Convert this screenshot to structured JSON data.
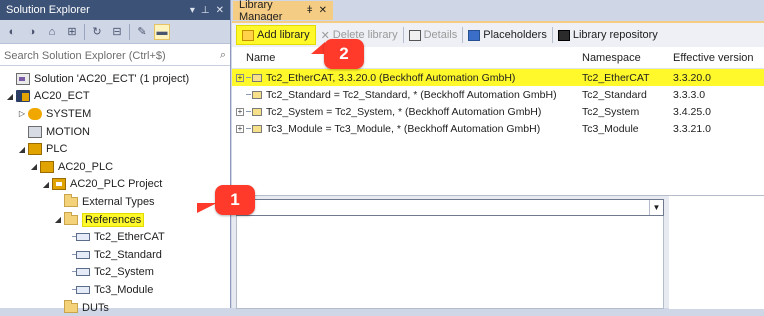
{
  "solution_explorer": {
    "title": "Solution Explorer",
    "title_icons": [
      "▾",
      "⊥",
      "✕"
    ],
    "search_placeholder": "Search Solution Explorer (Ctrl+$)",
    "search_icon": "⌕",
    "tree": [
      {
        "label": "Solution 'AC20_ECT' (1 project)",
        "icon": "solution-icon",
        "indent": 0,
        "expander": ""
      },
      {
        "label": "AC20_ECT",
        "icon": "project-icon",
        "indent": 0,
        "expander": "◢"
      },
      {
        "label": "SYSTEM",
        "icon": "system-icon",
        "indent": 1,
        "expander": "▷"
      },
      {
        "label": "MOTION",
        "icon": "motion-icon",
        "indent": 1,
        "expander": ""
      },
      {
        "label": "PLC",
        "icon": "plc-icon",
        "indent": 1,
        "expander": "◢"
      },
      {
        "label": "AC20_PLC",
        "icon": "plc-icon",
        "indent": 2,
        "expander": "◢"
      },
      {
        "label": "AC20_PLC Project",
        "icon": "plc-project-icon",
        "indent": 3,
        "expander": "◢"
      },
      {
        "label": "External Types",
        "icon": "folder-icon",
        "indent": 4,
        "expander": ""
      },
      {
        "label": "References",
        "icon": "folder-icon",
        "indent": 4,
        "expander": "◢",
        "selected": true
      },
      {
        "label": "Tc2_EtherCAT",
        "icon": "library-icon",
        "indent": 5,
        "expander": ""
      },
      {
        "label": "Tc2_Standard",
        "icon": "library-icon",
        "indent": 5,
        "expander": ""
      },
      {
        "label": "Tc2_System",
        "icon": "library-icon",
        "indent": 5,
        "expander": ""
      },
      {
        "label": "Tc3_Module",
        "icon": "library-icon",
        "indent": 5,
        "expander": ""
      },
      {
        "label": "DUTs",
        "icon": "folder-icon",
        "indent": 4,
        "expander": ""
      }
    ]
  },
  "library_manager": {
    "tab_label": "Library Manager",
    "tab_pin": "ǂ",
    "tab_close": "✕",
    "toolbar": {
      "add_library": "Add library",
      "delete_library": "Delete library",
      "details": "Details",
      "placeholders": "Placeholders",
      "library_repository": "Library repository"
    },
    "columns": {
      "name": "Name",
      "namespace": "Namespace",
      "effective_version": "Effective version"
    },
    "rows": [
      {
        "expander": "+",
        "name": "Tc2_EtherCAT, 3.3.20.0 (Beckhoff Automation GmbH)",
        "namespace": "Tc2_EtherCAT",
        "version": "3.3.20.0",
        "highlighted": true
      },
      {
        "expander": "",
        "name": "Tc2_Standard = Tc2_Standard, * (Beckhoff Automation GmbH)",
        "namespace": "Tc2_Standard",
        "version": "3.3.3.0",
        "highlighted": false
      },
      {
        "expander": "+",
        "name": "Tc2_System = Tc2_System, * (Beckhoff Automation GmbH)",
        "namespace": "Tc2_System",
        "version": "3.4.25.0",
        "highlighted": false
      },
      {
        "expander": "+",
        "name": "Tc3_Module = Tc3_Module, * (Beckhoff Automation GmbH)",
        "namespace": "Tc3_Module",
        "version": "3.3.21.0",
        "highlighted": false
      }
    ],
    "combo_arrow": "▼"
  },
  "callouts": {
    "first": "1",
    "second": "2"
  },
  "colors": {
    "highlight": "#fff82a",
    "callout": "#ff3a2a",
    "title_bar": "#3d5277",
    "tab_active": "#f5cc84"
  }
}
